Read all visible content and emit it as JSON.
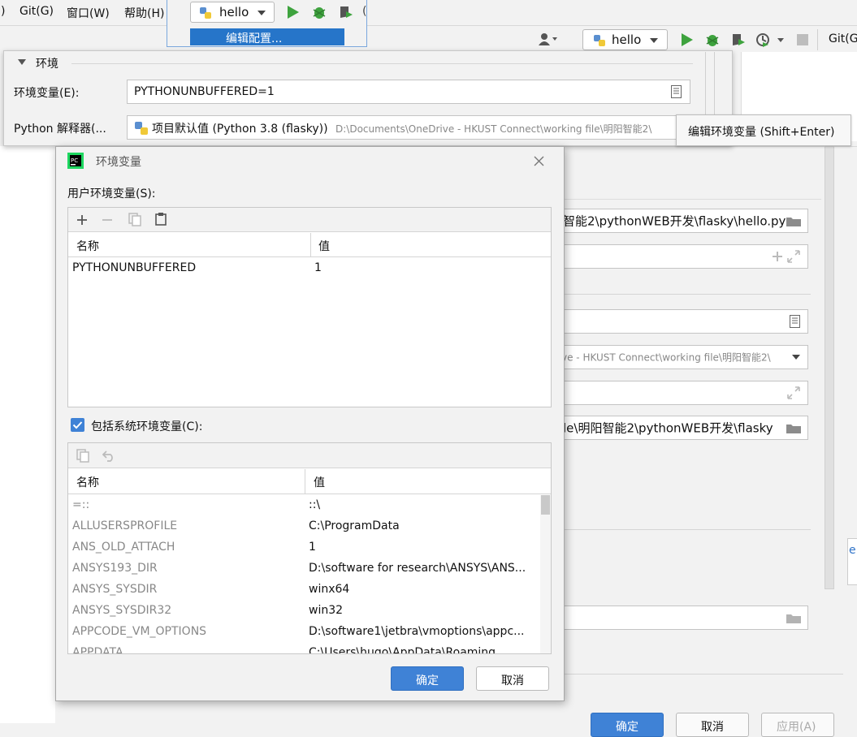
{
  "menu": {
    "partial_label": ")",
    "items": [
      "Git(G)",
      "窗口(W)",
      "帮助(H)"
    ]
  },
  "run_config_top": {
    "name": "hello",
    "dropdown_item": "编辑配置..."
  },
  "toolbar_right": {
    "run_config_name": "hello",
    "git_label": "Git(G"
  },
  "environment_panel": {
    "section_title": "环境",
    "env_vars_label": "环境变量(E):",
    "env_vars_value": "PYTHONUNBUFFERED=1",
    "interpreter_label": "Python 解释器(...",
    "interpreter_name": "项目默认值 (Python 3.8 (flasky))",
    "interpreter_path": "D:\\Documents\\OneDrive - HKUST Connect\\working file\\明阳智能2\\",
    "tooltip": "编辑环境变量 (Shift+Enter)"
  },
  "background_fields": {
    "script_path": "智能2\\pythonWEB开发\\flasky\\hello.py",
    "interpreter_partial": "ve - HKUST Connect\\working file\\明阳智能2\\",
    "working_dir": "le\\明阳智能2\\pythonWEB开发\\flasky",
    "right_edge_char": "e"
  },
  "dialog": {
    "title": "环境变量",
    "user_section_label": "用户环境变量(S):",
    "columns": {
      "name": "名称",
      "value": "值"
    },
    "user_vars": [
      {
        "name": "PYTHONUNBUFFERED",
        "value": "1"
      }
    ],
    "include_system_label": "包括系统环境变量(C):",
    "include_system_checked": true,
    "system_vars": [
      {
        "name": "=::",
        "value": "::\\"
      },
      {
        "name": "ALLUSERSPROFILE",
        "value": "C:\\ProgramData"
      },
      {
        "name": "ANS_OLD_ATTACH",
        "value": "1"
      },
      {
        "name": "ANSYS193_DIR",
        "value": "D:\\software for research\\ANSYS\\ANS..."
      },
      {
        "name": "ANSYS_SYSDIR",
        "value": "winx64"
      },
      {
        "name": "ANSYS_SYSDIR32",
        "value": "win32"
      },
      {
        "name": "APPCODE_VM_OPTIONS",
        "value": "D:\\software1\\jetbra\\vmoptions\\appc..."
      },
      {
        "name": "APPDATA",
        "value": "C:\\Users\\hugo\\AppData\\Roaming"
      }
    ],
    "ok_label": "确定",
    "cancel_label": "取消"
  },
  "bottom_buttons": {
    "ok_partial": "确定",
    "cancel_partial": "取消",
    "apply_partial": "应用(A)"
  },
  "colors": {
    "accent": "#2f73c8",
    "run_green": "#3ea33e",
    "selection": "#2675c9"
  }
}
